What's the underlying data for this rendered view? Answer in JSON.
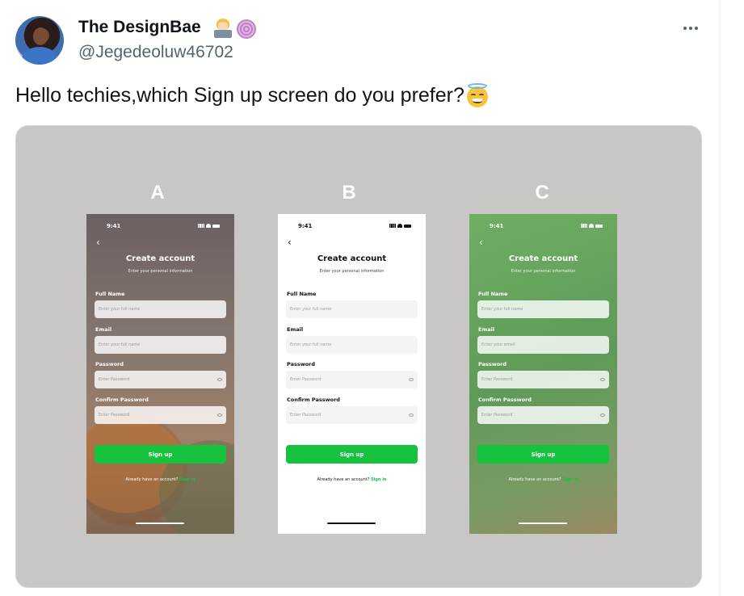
{
  "tweet": {
    "display_name": "The DesignBae",
    "handle": "@Jegedeoluw46702",
    "text": "Hello techies,which Sign up screen do you prefer?",
    "name_emojis": [
      "woman-technologist-emoji",
      "dizzy-swirl-emoji"
    ],
    "text_emoji": "smiling-face-with-halo-emoji"
  },
  "options": [
    {
      "letter": "A",
      "style": "photo-background"
    },
    {
      "letter": "B",
      "style": "white-background"
    },
    {
      "letter": "C",
      "style": "green-gradient-background"
    }
  ],
  "screens": {
    "a": {
      "time": "9:41",
      "back": "‹",
      "title": "Create account",
      "subtitle": "Enter your personal information",
      "full_name_label": "Full Name",
      "full_name_placeholder": "Enter your full name",
      "email_label": "Email",
      "email_placeholder": "Enter your full name",
      "password_label": "Password",
      "password_placeholder": "Enter Password",
      "confirm_label": "Confirm Password",
      "confirm_placeholder": "Enter Password",
      "signup_button": "Sign up",
      "have_account": "Already have an account?",
      "signin_link": "Sign in"
    },
    "b": {
      "time": "9:41",
      "back": "‹",
      "title": "Create account",
      "subtitle": "Enter your personal information",
      "full_name_label": "Full Name",
      "full_name_placeholder": "Enter your full name",
      "email_label": "Email",
      "email_placeholder": "Enter your full name",
      "password_label": "Password",
      "password_placeholder": "Enter Password",
      "confirm_label": "Confirm Password",
      "confirm_placeholder": "Enter Password",
      "signup_button": "Sign up",
      "have_account": "Already have an account?",
      "signin_link": "Sign in"
    },
    "c": {
      "time": "9:41",
      "back": "‹",
      "title": "Create account",
      "subtitle": "Enter your personal information",
      "full_name_label": "Full Name",
      "full_name_placeholder": "Enter your full name",
      "email_label": "Email",
      "email_placeholder": "Enter your email",
      "password_label": "Password",
      "password_placeholder": "Enter Password",
      "confirm_label": "Confirm Password",
      "confirm_placeholder": "Enter Password",
      "signup_button": "Sign up",
      "have_account": "Already have an account?",
      "signin_link": "Sign in"
    }
  },
  "colors": {
    "accent_green": "#16c23e",
    "text_primary": "#0f1419",
    "text_secondary": "#536471",
    "media_background": "#c8c7c6"
  }
}
